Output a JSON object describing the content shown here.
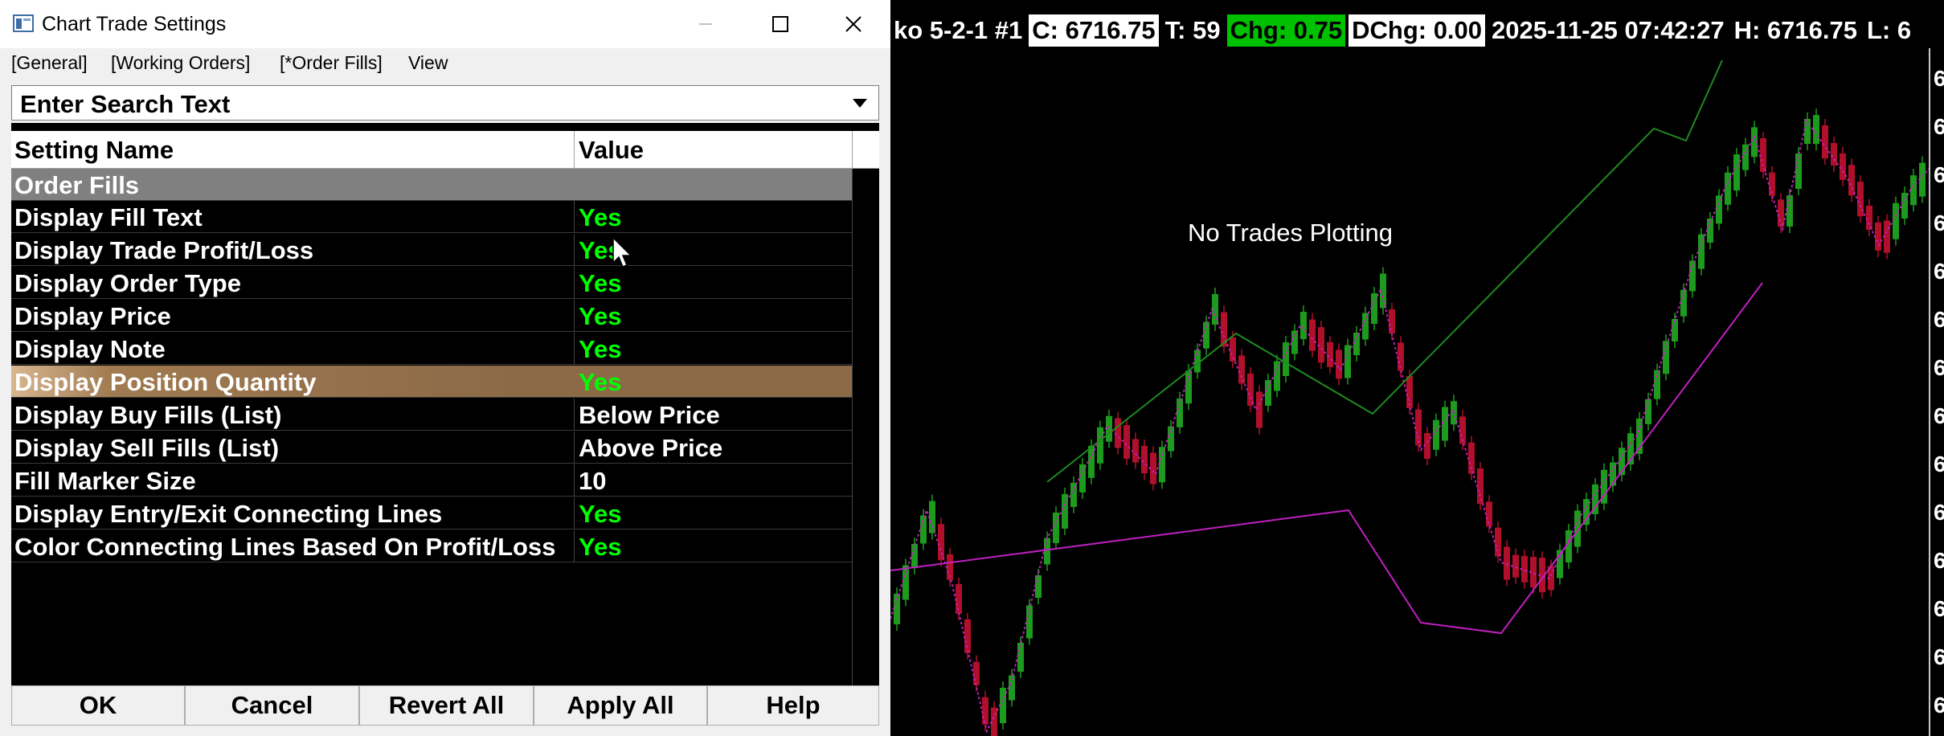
{
  "window": {
    "title": "Chart Trade Settings",
    "icon": "app-window-icon"
  },
  "menu": {
    "general": "[General]",
    "working_orders": "[Working Orders]",
    "order_fills": "[*Order Fills]",
    "view": "View"
  },
  "search": {
    "text": "Enter Search Text"
  },
  "grid": {
    "header_name": "Setting Name",
    "header_value": "Value",
    "section": "Order Fills",
    "rows": [
      {
        "name": "Display Fill Text",
        "value": "Yes"
      },
      {
        "name": "Display Trade Profit/Loss",
        "value": "Yes"
      },
      {
        "name": "Display Order Type",
        "value": "Yes"
      },
      {
        "name": "Display Price",
        "value": "Yes"
      },
      {
        "name": "Display Note",
        "value": "Yes"
      },
      {
        "name": "Display Position Quantity",
        "value": "Yes"
      },
      {
        "name": "Display Buy Fills (List)",
        "value": "Below Price"
      },
      {
        "name": "Display Sell Fills (List)",
        "value": "Above Price"
      },
      {
        "name": "Fill Marker Size",
        "value": "10"
      },
      {
        "name": "Display Entry/Exit Connecting Lines",
        "value": "Yes"
      },
      {
        "name": "Color Connecting Lines Based On Profit/Loss",
        "value": "Yes"
      }
    ]
  },
  "buttons": {
    "ok": "OK",
    "cancel": "Cancel",
    "revert_all": "Revert All",
    "apply_all": "Apply All",
    "help": "Help"
  },
  "chart": {
    "symbol": "ko 5-2-1 #1",
    "close": "C: 6716.75",
    "ticks": "T: 59",
    "change": "Chg: 0.75",
    "dchange": "DChg: 0.00",
    "datetime": "2025-11-25 07:42:27",
    "high": "H: 6716.75",
    "low": "L: 6",
    "message": "No Trades Plotting",
    "price_scale_labels": [
      "6",
      "6",
      "6",
      "6",
      "6",
      "6",
      "6",
      "6",
      "6",
      "6",
      "6",
      "6",
      "6",
      "6"
    ],
    "colors": {
      "up_bar": "#1e9a1e",
      "down_bar": "#b0102a",
      "line_green": "#1f8a1f",
      "line_magenta": "#c020c0",
      "change_bg": "#00c000",
      "selected_row": "#8c6a48",
      "value_green": "#00ff00"
    }
  }
}
